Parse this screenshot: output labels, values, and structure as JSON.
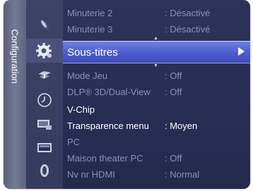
{
  "sidebar": {
    "label": "Configuration"
  },
  "icons": [
    "picture-icon",
    "setup-gear-icon",
    "channel-satellite-icon",
    "time-clock-icon",
    "input-icon",
    "application-icon",
    "support-icon"
  ],
  "menu": {
    "rows": [
      {
        "name": "Minuterie 2",
        "value": ": Désactivé",
        "state": "dim"
      },
      {
        "name": "Minuterie 3",
        "value": ": Désactivé",
        "state": "dim"
      },
      {
        "name": "Sous-titres",
        "value": "",
        "state": "selected"
      },
      {
        "name": "Mode Jeu",
        "value": ": Off",
        "state": "dim"
      },
      {
        "name": "DLP® 3D/Dual-View",
        "value": ": Off",
        "state": "dim"
      },
      {
        "name": "V-Chip",
        "value": "",
        "state": "on"
      },
      {
        "name": "Transparence menu",
        "value": ": Moyen",
        "state": "on"
      },
      {
        "name": "PC",
        "value": "",
        "state": "dim"
      },
      {
        "name": "Maison theater PC",
        "value": ": Off",
        "state": "dim"
      },
      {
        "name": "Nv nr HDMI",
        "value": ": Normal",
        "state": "dim"
      }
    ]
  },
  "colors": {
    "background": "#2b2f55",
    "highlight": "#5a6ad8",
    "text_active": "#ffffff",
    "text_dim": "#8a90b4"
  }
}
